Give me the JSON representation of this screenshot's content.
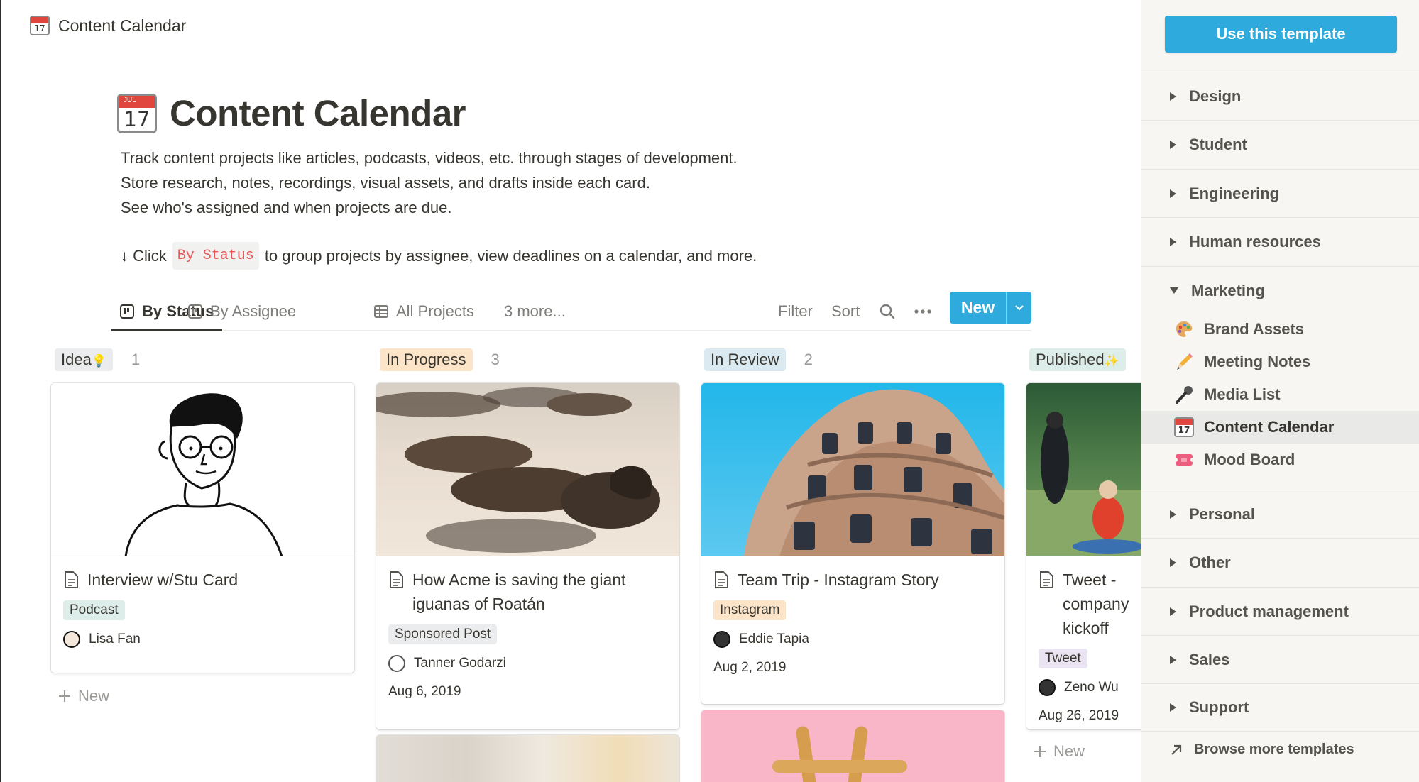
{
  "topbar": {
    "title": "Content Calendar",
    "icon_day": "17"
  },
  "page": {
    "title": "Content Calendar",
    "icon_month": "JUL",
    "icon_day": "17",
    "description": [
      "Track content projects like articles, podcasts, videos, etc. through stages of development.",
      "Store research, notes, recordings, visual assets, and drafts inside each card.",
      "See who's assigned and when projects are due."
    ],
    "hint_prefix": "↓ Click",
    "hint_code": "By Status",
    "hint_suffix": "to group projects by assignee, view deadlines on a calendar, and more."
  },
  "tabs": [
    {
      "label": "By Status",
      "icon": "board-icon",
      "active": true
    },
    {
      "label": "By Assignee",
      "icon": "board-icon",
      "active": false
    },
    {
      "label": "All Projects",
      "icon": "table-icon",
      "active": false
    },
    {
      "label": "3 more...",
      "icon": "",
      "active": false
    }
  ],
  "toolbar": {
    "filter": "Filter",
    "sort": "Sort",
    "new": "New"
  },
  "colors": {
    "accent": "#2eaadc",
    "text": "#37352f",
    "muted": "#9b9a97"
  },
  "columns": [
    {
      "name": "Idea",
      "suffix": "💡",
      "count": "1",
      "color": "#ebeced"
    },
    {
      "name": "In Progress",
      "suffix": "",
      "count": "3",
      "color": "#fbe4c8"
    },
    {
      "name": "In Review",
      "suffix": "",
      "count": "2",
      "color": "#dbe9f1"
    },
    {
      "name": "Published",
      "suffix": "✨",
      "count": "",
      "color": "#ddedea"
    }
  ],
  "cards": [
    {
      "title": "Interview w/Stu Card",
      "tag": "Podcast",
      "tag_color": "#ddedea",
      "person": "Lisa Fan",
      "date": ""
    },
    {
      "title": "How Acme is saving the giant iguanas of Roatán",
      "tag": "Sponsored Post",
      "tag_color": "#ebeced",
      "person": "Tanner Godarzi",
      "date": "Aug 6, 2019"
    },
    {
      "title": "Team Trip - Instagram Story",
      "tag": "Instagram",
      "tag_color": "#fbe4c8",
      "person": "Eddie Tapia",
      "date": "Aug 2, 2019"
    },
    {
      "title": "Tweet - company kickoff",
      "tag": "Tweet",
      "tag_color": "#eae4f2",
      "person": "Zeno Wu",
      "date": "Aug 26, 2019"
    }
  ],
  "board": {
    "add_new": "New"
  },
  "sidebar": {
    "cta": "Use this template",
    "categories": [
      "Design",
      "Student",
      "Engineering",
      "Human resources",
      "Marketing",
      "Personal",
      "Other",
      "Product management",
      "Sales",
      "Support"
    ],
    "expanded": "Marketing",
    "marketing_items": [
      {
        "label": "Brand Assets",
        "icon": "palette-icon"
      },
      {
        "label": "Meeting Notes",
        "icon": "pencil-icon"
      },
      {
        "label": "Media List",
        "icon": "microphone-icon"
      },
      {
        "label": "Content Calendar",
        "icon": "calendar-icon",
        "selected": true
      },
      {
        "label": "Mood Board",
        "icon": "ticket-icon"
      }
    ],
    "browse": "Browse more templates"
  }
}
